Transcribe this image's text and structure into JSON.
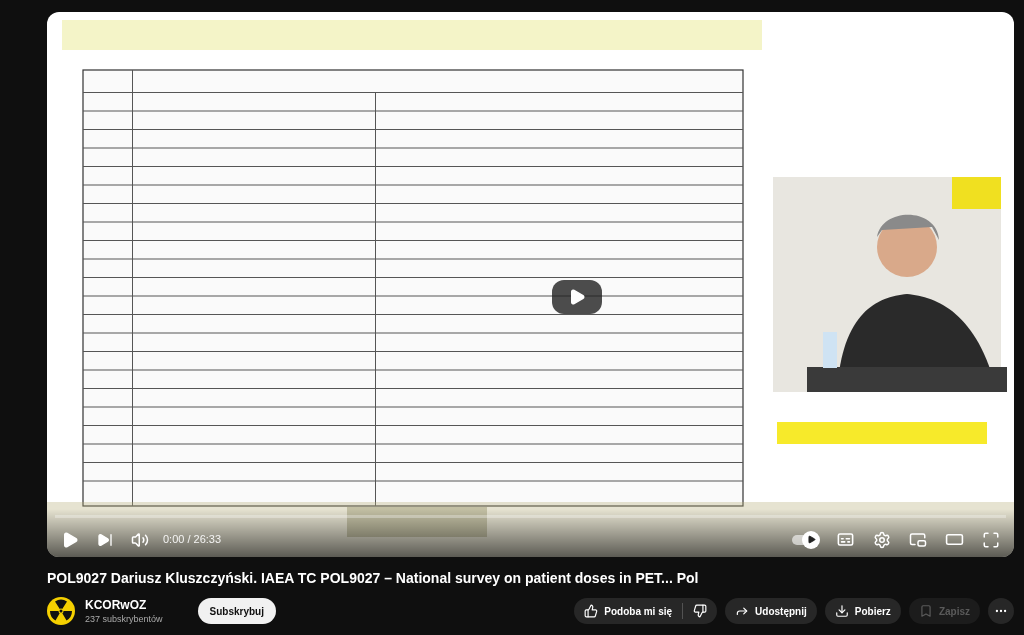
{
  "player": {
    "time": "0:00 / 26:33",
    "progress": {
      "level": 0
    },
    "autoplay": {
      "on": true
    }
  },
  "title": "POL9027 Dariusz Kluszczyński. IAEA TC POL9027 – National survey on patient doses in PET... Pol",
  "channel": {
    "name": "KCORwOZ",
    "subscribers": "237 subskrybentów"
  },
  "subscribe": "Subskrybuj",
  "like": {
    "label": "Podoba mi się"
  },
  "actions": [
    {
      "kind": "share",
      "label": "Udostępnij",
      "disabled": false
    },
    {
      "kind": "download",
      "label": "Pobierz",
      "disabled": false
    },
    {
      "kind": "save",
      "label": "Zapisz",
      "disabled": true
    }
  ]
}
